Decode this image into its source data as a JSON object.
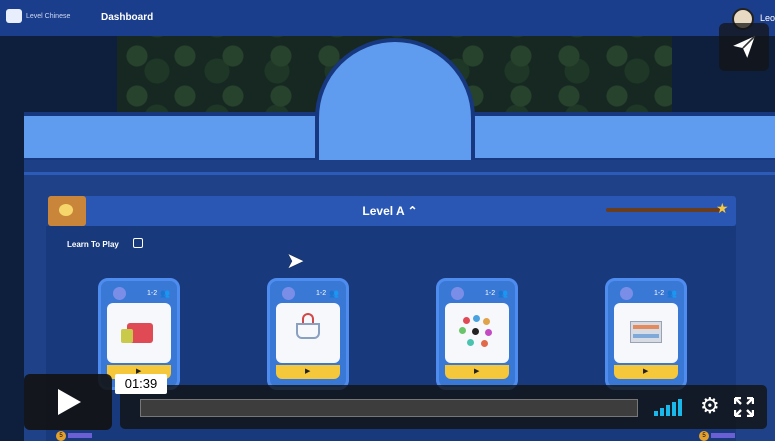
{
  "app": {
    "logo_text": "Level Chinese",
    "nav_dashboard": "Dashboard",
    "user_name": "Leo"
  },
  "level": {
    "title": "Level A ⌃",
    "section_label": "Learn To Play",
    "cards": [
      {
        "ages": "1-2",
        "play_symbol": "▶"
      },
      {
        "ages": "1-2",
        "play_symbol": "▶"
      },
      {
        "ages": "1-2",
        "play_symbol": "▶"
      },
      {
        "ages": "1-2",
        "play_symbol": "▶"
      }
    ],
    "bottom_counts": [
      "5",
      "5"
    ]
  },
  "player": {
    "current_time": "01:39",
    "progress_fraction": 0,
    "volume_level": 1.0,
    "icons": {
      "share": "paper-plane-icon",
      "play": "play-icon",
      "settings": "gear-icon",
      "fullscreen": "fullscreen-icon"
    }
  },
  "colors": {
    "banner_blue": "#5f9bef",
    "panel_blue": "#1e4188",
    "volume_accent": "#19b7ea",
    "card_footer": "#f5c73a"
  }
}
